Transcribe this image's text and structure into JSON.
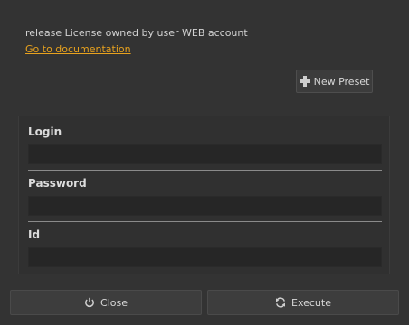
{
  "header": {
    "description": "release License owned by user WEB account",
    "doc_link": "Go to documentation"
  },
  "toolbar": {
    "new_preset_label": "New Preset",
    "new_preset_icon": "plus-icon"
  },
  "form": {
    "fields": [
      {
        "label": "Login",
        "value": "",
        "placeholder": ""
      },
      {
        "label": "Password",
        "value": "",
        "placeholder": ""
      },
      {
        "label": "Id",
        "value": "",
        "placeholder": ""
      }
    ]
  },
  "footer": {
    "close_label": "Close",
    "close_icon": "power-icon",
    "execute_label": "Execute",
    "execute_icon": "refresh-icon"
  },
  "colors": {
    "background": "#333333",
    "link": "#e8a21e",
    "input_bg": "#262626"
  }
}
